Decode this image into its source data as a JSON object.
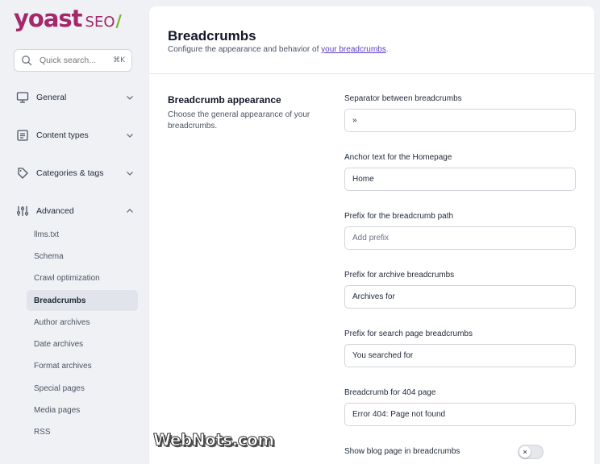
{
  "brand": {
    "name": "yoast",
    "product": "SEO",
    "slash": "/",
    "color": "#a4286a",
    "accent": "#77b227"
  },
  "search": {
    "placeholder": "Quick search...",
    "shortcut": "⌘K"
  },
  "nav": {
    "groups": [
      {
        "label": "General",
        "icon": "monitor-icon",
        "expanded": false
      },
      {
        "label": "Content types",
        "icon": "document-icon",
        "expanded": false
      },
      {
        "label": "Categories & tags",
        "icon": "tag-icon",
        "expanded": false
      },
      {
        "label": "Advanced",
        "icon": "sliders-icon",
        "expanded": true
      }
    ],
    "advanced_items": [
      {
        "label": "llms.txt",
        "active": false
      },
      {
        "label": "Schema",
        "active": false
      },
      {
        "label": "Crawl optimization",
        "active": false
      },
      {
        "label": "Breadcrumbs",
        "active": true
      },
      {
        "label": "Author archives",
        "active": false
      },
      {
        "label": "Date archives",
        "active": false
      },
      {
        "label": "Format archives",
        "active": false
      },
      {
        "label": "Special pages",
        "active": false
      },
      {
        "label": "Media pages",
        "active": false
      },
      {
        "label": "RSS",
        "active": false
      }
    ]
  },
  "page": {
    "title": "Breadcrumbs",
    "subtitle_prefix": "Configure the appearance and behavior of ",
    "subtitle_link": "your breadcrumbs",
    "subtitle_suffix": "."
  },
  "section": {
    "title": "Breadcrumb appearance",
    "description": "Choose the general appearance of your breadcrumbs."
  },
  "fields": [
    {
      "label": "Separator between breadcrumbs",
      "value": "»",
      "placeholder": ""
    },
    {
      "label": "Anchor text for the Homepage",
      "value": "Home",
      "placeholder": ""
    },
    {
      "label": "Prefix for the breadcrumb path",
      "value": "",
      "placeholder": "Add prefix"
    },
    {
      "label": "Prefix for archive breadcrumbs",
      "value": "Archives for",
      "placeholder": ""
    },
    {
      "label": "Prefix for search page breadcrumbs",
      "value": "You searched for",
      "placeholder": ""
    },
    {
      "label": "Breadcrumb for 404 page",
      "value": "Error 404: Page not found",
      "placeholder": ""
    }
  ],
  "toggle": {
    "label": "Show blog page in breadcrumbs",
    "on": false,
    "symbol": "✕"
  },
  "watermark": "WebNots.com"
}
